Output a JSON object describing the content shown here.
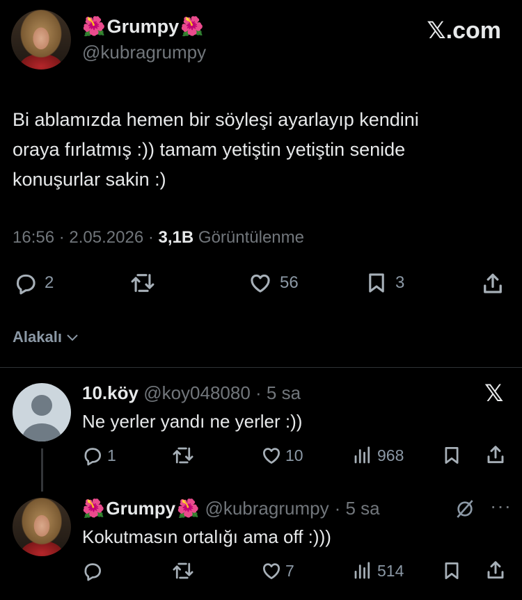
{
  "header": {
    "display_name": "Grumpy",
    "flower_glyph": "🌺",
    "handle": "@kubragrumpy",
    "brand": "𝕏.com"
  },
  "tweet": {
    "text_lines": [
      "Bi ablamızda hemen bir söyleşi ayarlayıp kendini",
      "oraya fırlatmış :)) tamam yetiştin yetiştin senide",
      "konuşurlar sakin :)"
    ],
    "time": "16:56",
    "date": "2.05.2026",
    "views": "3,1B",
    "views_label": "Görüntülenme",
    "replies": "2",
    "likes": "56",
    "bookmarks": "3"
  },
  "sort": {
    "label": "Alakalı"
  },
  "replies": [
    {
      "name": "10.köy",
      "handle": "@koy048080",
      "time": "· 5 sa",
      "text": "Ne yerler yandı ne yerler :))",
      "reply_count": "1",
      "like_count": "10",
      "view_count": "968"
    },
    {
      "name": "Grumpy",
      "handle": "@kubragrumpy",
      "time": "· 5 sa",
      "text": "Kokutmasın ortalığı ama off :)))",
      "reply_count": "",
      "like_count": "7",
      "view_count": "514"
    }
  ],
  "colors": {
    "background": "#000000",
    "text": "#e7e9ea",
    "muted": "#71767b",
    "divider": "#2f3336",
    "flower": "#e0245e"
  }
}
